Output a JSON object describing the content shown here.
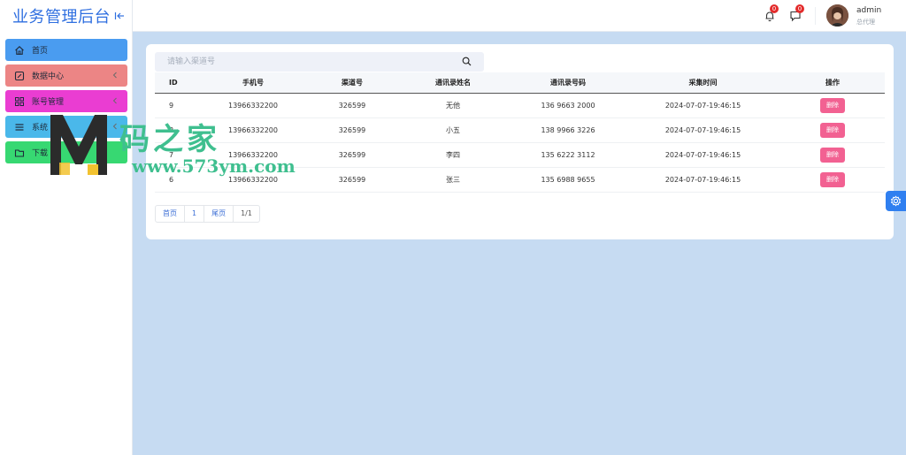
{
  "brand": {
    "title": "业务管理后台"
  },
  "sidebar": {
    "items": [
      {
        "label": "首页",
        "icon": "home-icon",
        "has_children": false
      },
      {
        "label": "数据中心",
        "icon": "edit-icon",
        "has_children": true
      },
      {
        "label": "账号管理",
        "icon": "grid-icon",
        "has_children": true
      },
      {
        "label": "系统",
        "icon": "list-icon",
        "has_children": true
      },
      {
        "label": "下载",
        "icon": "folder-icon",
        "has_children": false
      }
    ]
  },
  "header": {
    "notifications_count": "0",
    "messages_count": "0",
    "user_name": "admin",
    "user_role": "总代理"
  },
  "search": {
    "placeholder": "请输入渠道号"
  },
  "table": {
    "columns": [
      "ID",
      "手机号",
      "渠道号",
      "通讯录姓名",
      "通讯录号码",
      "采集时间",
      "操作"
    ],
    "rows": [
      {
        "id": "9",
        "phone": "13966332200",
        "channel": "326599",
        "contact_name": "无他",
        "contact_number": "136 9663 2000",
        "time": "2024-07-07-19:46:15",
        "action": "删除"
      },
      {
        "id": "8",
        "phone": "13966332200",
        "channel": "326599",
        "contact_name": "小五",
        "contact_number": "138 9966 3226",
        "time": "2024-07-07-19:46:15",
        "action": "删除"
      },
      {
        "id": "7",
        "phone": "13966332200",
        "channel": "326599",
        "contact_name": "李四",
        "contact_number": "135 6222 3112",
        "time": "2024-07-07-19:46:15",
        "action": "删除"
      },
      {
        "id": "6",
        "phone": "13966332200",
        "channel": "326599",
        "contact_name": "张三",
        "contact_number": "135 6988 9655",
        "time": "2024-07-07-19:46:15",
        "action": "删除"
      }
    ]
  },
  "pagination": {
    "first": "首页",
    "current": "1",
    "last": "尾页",
    "info": "1/1"
  },
  "watermark": {
    "text": "码之家",
    "url": "www.573ym.com"
  },
  "colors": {
    "brand": "#2f6fe0",
    "menu_home": "#4a9cf0",
    "menu_data": "#ec8585",
    "menu_account": "#ea3dd2",
    "menu_system": "#4ab8ea",
    "menu_download": "#37d872",
    "delete_button": "#f26192",
    "badge": "#e32b2b"
  }
}
